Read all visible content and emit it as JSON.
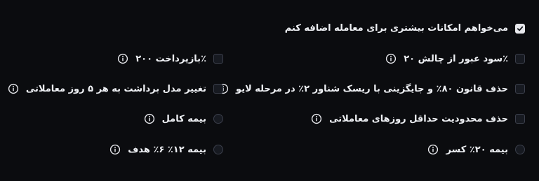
{
  "main_option": {
    "label": "می‌خواهم امکانات بیشتری برای معامله اضافه کنم",
    "checked": true
  },
  "right_column": [
    {
      "label": "سود عبور از چالش ۲۰٪",
      "control": "checkbox",
      "checked": false,
      "info_icon": "info-icon"
    },
    {
      "label": "حذف قانون ۸۰٪ و جایگزینی با ریسک شناور ۲٪ در مرحله لایو",
      "control": "checkbox",
      "checked": false,
      "info_icon": "info-icon"
    },
    {
      "label": "حذف محدودیت حداقل روزهای معاملاتی",
      "control": "checkbox",
      "checked": false,
      "info_icon": "info-icon"
    },
    {
      "label": "بیمه ۲۰٪ کسر",
      "control": "radio",
      "checked": false,
      "info_icon": "info-icon"
    }
  ],
  "left_column": [
    {
      "label": "بازپرداخت ۲۰۰٪",
      "control": "checkbox",
      "checked": false,
      "info_icon": "info-icon"
    },
    {
      "label": "تغییر مدل برداشت به هر ۵ روز معاملاتی",
      "control": "checkbox",
      "checked": false,
      "info_icon": "info-icon"
    },
    {
      "label": "بیمه کامل",
      "control": "radio",
      "checked": false,
      "info_icon": "info-icon"
    },
    {
      "label": "بیمه ۱۲٪ ۶٪ هدف",
      "control": "radio",
      "checked": false,
      "info_icon": "info-icon"
    }
  ],
  "colors": {
    "background": "#0b0c0f",
    "text": "#eef0f4",
    "control_border": "#3b3f4b",
    "checked_fill": "#e8e9ed"
  }
}
